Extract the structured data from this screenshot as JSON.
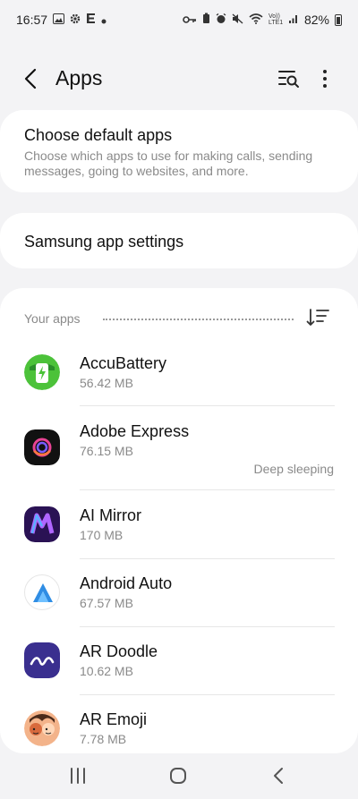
{
  "status_bar": {
    "time": "16:57",
    "left_icons": [
      "gallery-icon",
      "settings-gear-icon",
      "e-app-icon",
      "dot-icon"
    ],
    "right_icons": [
      "key-icon",
      "battery-saver-icon",
      "alarm-icon",
      "mute-icon",
      "wifi-icon",
      "volte-icon",
      "signal-icon"
    ],
    "volte_text": "Vo)) LTE1",
    "battery": "82%"
  },
  "toolbar": {
    "title": "Apps"
  },
  "default_apps": {
    "title": "Choose default apps",
    "subtitle": "Choose which apps to use for making calls, sending messages, going to websites, and more."
  },
  "samsung_settings": {
    "title": "Samsung app settings"
  },
  "your_apps": {
    "label": "Your apps",
    "apps": [
      {
        "name": "AccuBattery",
        "size": "56.42 MB",
        "status": "",
        "icon": "accubattery-icon"
      },
      {
        "name": "Adobe Express",
        "size": "76.15 MB",
        "status": "Deep sleeping",
        "icon": "adobe-express-icon"
      },
      {
        "name": "AI Mirror",
        "size": "170 MB",
        "status": "",
        "icon": "ai-mirror-icon"
      },
      {
        "name": "Android Auto",
        "size": "67.57 MB",
        "status": "",
        "icon": "android-auto-icon"
      },
      {
        "name": "AR Doodle",
        "size": "10.62 MB",
        "status": "",
        "icon": "ar-doodle-icon"
      },
      {
        "name": "AR Emoji",
        "size": "7.78 MB",
        "status": "",
        "icon": "ar-emoji-icon"
      }
    ]
  },
  "colors": {
    "background": "#f3f3f5",
    "card": "#ffffff",
    "secondary_text": "#8a8a8a",
    "accubattery_green": "#4cc23a",
    "android_auto_blue": "#2f8de4",
    "ai_mirror_purple": "#6b2bd9"
  }
}
